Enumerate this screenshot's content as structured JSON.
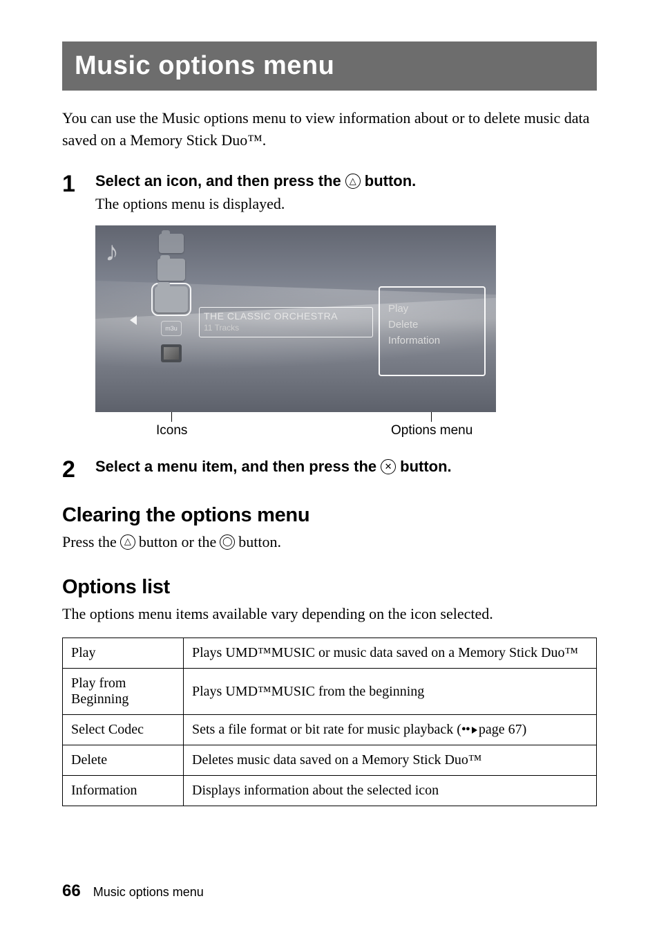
{
  "title": "Music options menu",
  "intro": "You can use the Music options menu to view information about or to delete music data saved on a Memory Stick Duo™.",
  "step1": {
    "num": "1",
    "heading_a": "Select an icon, and then press the",
    "heading_b": "button.",
    "sub": "The options menu is displayed."
  },
  "screenshot": {
    "item_title": "THE CLASSIC ORCHESTRA",
    "item_sub": "11 Tracks",
    "m3u_label": "m3u",
    "menu": {
      "opt1": "Play",
      "opt2": "Delete",
      "opt3": "Information"
    },
    "callout_left": "Icons",
    "callout_right": "Options menu"
  },
  "step2": {
    "num": "2",
    "heading_a": "Select a menu item, and then press the",
    "heading_b": "button."
  },
  "clearing": {
    "heading": "Clearing the options menu",
    "text_a": "Press the",
    "text_b": "button or the",
    "text_c": "button."
  },
  "options_list": {
    "heading": "Options list",
    "intro": "The options menu items available vary depending on the icon selected.",
    "rows": [
      {
        "name": "Play",
        "desc": "Plays UMD™MUSIC or music data saved on a Memory Stick Duo™"
      },
      {
        "name": "Play from Beginning",
        "desc": "Plays UMD™MUSIC from the beginning"
      },
      {
        "name": "Select Codec",
        "desc_a": "Sets a file format or bit rate for music playback (",
        "desc_b": "page 67)"
      },
      {
        "name": "Delete",
        "desc": "Deletes music data saved on a Memory Stick Duo™"
      },
      {
        "name": "Information",
        "desc": "Displays information about the selected icon"
      }
    ]
  },
  "footer": {
    "page": "66",
    "label": "Music options menu"
  },
  "glyphs": {
    "triangle": "△",
    "cross": "✕",
    "circle": "◯"
  }
}
